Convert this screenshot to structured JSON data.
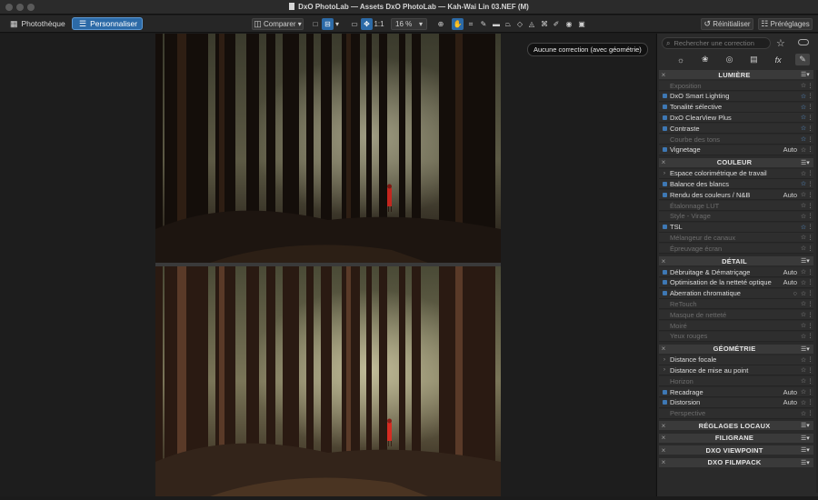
{
  "window": {
    "title": "DxO PhotoLab — Assets DxO PhotoLab — Kah-Wai Lin 03.NEF (M)"
  },
  "toolbar": {
    "tabs": [
      {
        "label": "Photothèque",
        "icon": "grid-icon",
        "active": false
      },
      {
        "label": "Personnaliser",
        "icon": "sliders-icon",
        "active": true
      }
    ],
    "compare_label": "Comparer",
    "zoom_1to1": "1:1",
    "zoom_value": "16 %",
    "reset_label": "Réinitialiser",
    "presets_label": "Préréglages"
  },
  "viewer": {
    "tooltip": "Aucune correction (avec géométrie)"
  },
  "panel": {
    "search_placeholder": "Rechercher une correction",
    "sections": [
      {
        "name": "LUMIÈRE",
        "rows": [
          {
            "label": "Exposition",
            "on": false,
            "value": "",
            "star": false
          },
          {
            "label": "DxO Smart Lighting",
            "on": true,
            "value": "",
            "star": true
          },
          {
            "label": "Tonalité sélective",
            "on": true,
            "value": "",
            "star": true
          },
          {
            "label": "DxO ClearView Plus",
            "on": true,
            "value": "",
            "star": true
          },
          {
            "label": "Contraste",
            "on": true,
            "value": "",
            "star": true
          },
          {
            "label": "Courbe des tons",
            "on": false,
            "value": "",
            "star": true
          },
          {
            "label": "Vignetage",
            "on": true,
            "value": "Auto",
            "star": false
          }
        ]
      },
      {
        "name": "COULEUR",
        "rows": [
          {
            "label": "Espace colorimétrique de travail",
            "on": false,
            "expand": true,
            "value": "",
            "star": false
          },
          {
            "label": "Balance des blancs",
            "on": true,
            "value": "",
            "star": true
          },
          {
            "label": "Rendu des couleurs / N&B",
            "on": true,
            "value": "Auto",
            "star": false
          },
          {
            "label": "Étalonnage LUT",
            "on": false,
            "value": "",
            "star": false
          },
          {
            "label": "Style - Virage",
            "on": false,
            "value": "",
            "star": false
          },
          {
            "label": "TSL",
            "on": true,
            "value": "",
            "star": true
          },
          {
            "label": "Mélangeur de canaux",
            "on": false,
            "value": "",
            "star": false
          },
          {
            "label": "Épreuvage écran",
            "on": false,
            "value": "",
            "star": false
          }
        ]
      },
      {
        "name": "DÉTAIL",
        "rows": [
          {
            "label": "Débruitage & Dématriçage",
            "on": true,
            "value": "Auto",
            "star": false
          },
          {
            "label": "Optimisation de la netteté optique",
            "on": true,
            "value": "Auto",
            "star": false
          },
          {
            "label": "Aberration chromatique",
            "on": true,
            "value": "",
            "star": false,
            "eye": true
          },
          {
            "label": "ReTouch",
            "on": false,
            "value": "",
            "star": false
          },
          {
            "label": "Masque de netteté",
            "on": false,
            "value": "",
            "star": false
          },
          {
            "label": "Moiré",
            "on": false,
            "value": "",
            "star": false
          },
          {
            "label": "Yeux rouges",
            "on": false,
            "value": "",
            "star": false
          }
        ]
      },
      {
        "name": "GÉOMÉTRIE",
        "rows": [
          {
            "label": "Distance focale",
            "on": false,
            "expand": true,
            "value": "",
            "star": false
          },
          {
            "label": "Distance de mise au point",
            "on": false,
            "expand": true,
            "value": "",
            "star": false
          },
          {
            "label": "Horizon",
            "on": false,
            "value": "",
            "star": false
          },
          {
            "label": "Recadrage",
            "on": true,
            "value": "Auto",
            "star": false
          },
          {
            "label": "Distorsion",
            "on": true,
            "value": "Auto",
            "star": false
          },
          {
            "label": "Perspective",
            "on": false,
            "value": "",
            "star": false
          }
        ]
      }
    ],
    "collapsed_sections": [
      "RÉGLAGES LOCAUX",
      "FILIGRANE",
      "DXO VIEWPOINT",
      "DXO FILMPACK"
    ]
  },
  "colors": {
    "accent": "#2c6aa7",
    "star_on": "#5ea0e6",
    "panel_bg": "#2a2a2a"
  }
}
